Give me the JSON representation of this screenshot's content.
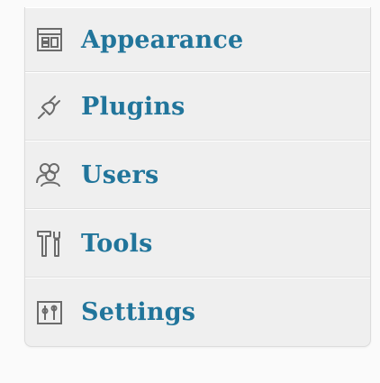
{
  "menu": {
    "items": [
      {
        "label": "Appearance",
        "icon": "appearance-icon"
      },
      {
        "label": "Plugins",
        "icon": "plug-icon"
      },
      {
        "label": "Users",
        "icon": "users-icon"
      },
      {
        "label": "Tools",
        "icon": "tools-icon"
      },
      {
        "label": "Settings",
        "icon": "settings-icon"
      }
    ],
    "colors": {
      "link": "#21759b",
      "background": "#efefef",
      "icon": "#6b6b6b"
    }
  }
}
